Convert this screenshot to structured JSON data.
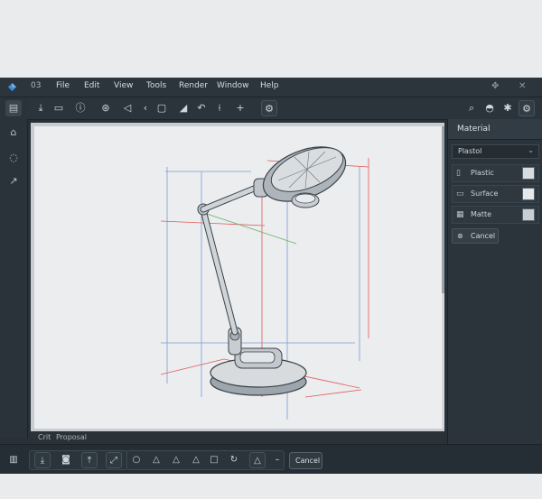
{
  "menubar": {
    "logo": "diamond-logo",
    "doc_label": "03",
    "items": [
      "File",
      "Edit",
      "View",
      "Tools",
      "Render",
      "Window",
      "Help"
    ],
    "window_controls": [
      "move-icon",
      "close-icon"
    ]
  },
  "toolbar": {
    "icons": [
      "import-icon",
      "folder-icon",
      "info-icon",
      "snap-icon",
      "select-icon",
      "back-icon",
      "frame-icon",
      "sketch-icon",
      "undo-icon",
      "axis-icon",
      "add-icon",
      "settings-icon"
    ],
    "right_icons": [
      "search-icon",
      "material-ball-icon",
      "light-icon",
      "render-settings-icon"
    ]
  },
  "leftbar": {
    "icons": [
      "panel-icon",
      "home-icon",
      "orbit-icon",
      "transform-icon"
    ]
  },
  "viewport": {
    "status": {
      "icon_label": "Crit",
      "label": "Proposal"
    }
  },
  "rightpanel": {
    "title": "Material",
    "dropdown_value": "Plastol",
    "rows": [
      {
        "icon": "material-icon",
        "label": "Plastic",
        "swatch": "#d8dcdf"
      },
      {
        "icon": "surface-icon",
        "label": "Surface",
        "swatch": "#e6e9eb"
      },
      {
        "icon": "texture-icon",
        "label": "Matte",
        "swatch": "#c9ced2"
      }
    ],
    "cancel_label": "Cancel"
  },
  "bottombar": {
    "icons": [
      "library-icon",
      "import-icon",
      "camera-icon",
      "export-icon",
      "scale-icon",
      "circle-icon",
      "triangle-icon",
      "triangle-icon",
      "triangle-icon",
      "square-icon",
      "refresh-icon",
      "warning-icon",
      "minus-icon"
    ],
    "cancel_label": "Cancel"
  },
  "colors": {
    "accent": "#3d8fd8",
    "panel": "#283138",
    "viewport": "#ebedef"
  }
}
